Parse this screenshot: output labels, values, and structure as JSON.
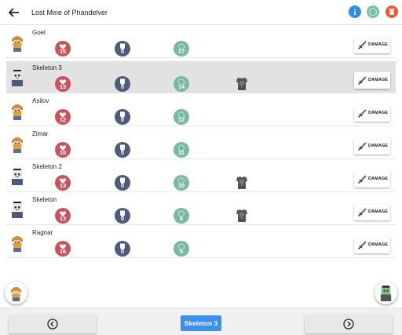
{
  "header": {
    "title": "Lost Mine of Phandelver",
    "icons": [
      "back-arrow-icon",
      "info-icon",
      "round-icon",
      "trash-icon"
    ],
    "colors": {
      "info": "#2a8fe5",
      "round": "#78c29d",
      "trash": "#ee5a2e"
    }
  },
  "damage_label": "DAMAGE",
  "combatants": [
    {
      "name": "Goel",
      "hp": "15",
      "ac": "0",
      "init": "17",
      "armor": "",
      "type": "dwarf"
    },
    {
      "name": "Skeleton 3",
      "hp": "13",
      "ac": "0",
      "init": "14",
      "armor": "13",
      "type": "skeleton",
      "active": true
    },
    {
      "name": "Asilov",
      "hp": "12",
      "ac": "0",
      "init": "12",
      "armor": "",
      "type": "dwarf"
    },
    {
      "name": "Zimar",
      "hp": "10",
      "ac": "0",
      "init": "11",
      "armor": "",
      "type": "dwarf"
    },
    {
      "name": "Skeleton 2",
      "hp": "13",
      "ac": "0",
      "init": "10",
      "armor": "13",
      "type": "skeleton"
    },
    {
      "name": "Skeleton",
      "hp": "13",
      "ac": "0",
      "init": "6",
      "armor": "13",
      "type": "skeleton"
    },
    {
      "name": "Ragnar",
      "hp": "16",
      "ac": "0",
      "init": "5",
      "armor": "",
      "type": "dwarf"
    }
  ],
  "footer": {
    "current_turn": "Skeleton 3",
    "prev_icon": "chevron-left-icon",
    "next_icon": "chevron-right-icon"
  },
  "colors": {
    "hp": "#c8535a",
    "ac": "#4d5b7d",
    "init": "#78b9a3",
    "accent": "#3d8eea"
  }
}
